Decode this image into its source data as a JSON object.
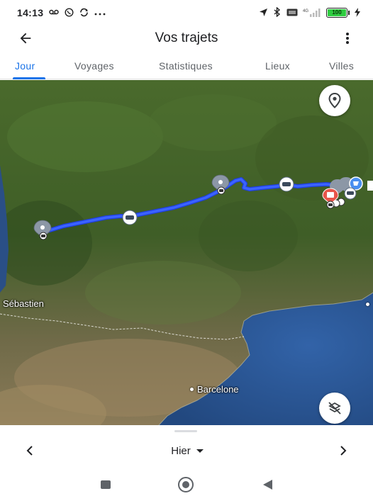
{
  "status_bar": {
    "time": "14:13",
    "left_icons": [
      "voicemail-icon",
      "whatsapp-icon",
      "sync-icon",
      "more-dots-icon"
    ],
    "right_icons": [
      "location-arrow-icon",
      "bluetooth-icon",
      "volte-icon",
      "signal-4g-icon",
      "battery-icon",
      "charging-icon"
    ],
    "signal_label": "4G",
    "battery_level": "100"
  },
  "app_bar": {
    "title": "Vos trajets",
    "back_icon": "arrow-back-icon",
    "menu_icon": "more-vert-icon"
  },
  "tabs": [
    {
      "label": "Jour",
      "active": true
    },
    {
      "label": "Voyages",
      "active": false
    },
    {
      "label": "Statistiques",
      "active": false
    },
    {
      "label": "Lieux",
      "active": false
    },
    {
      "label": "Villes",
      "active": false
    }
  ],
  "map": {
    "labels": {
      "san_sebastian": "Sébastien",
      "barcelona": "Barcelone"
    },
    "route_color": "#2f5bff",
    "fab_top_icon": "place-icon",
    "fab_bottom_icon": "layers-off-icon"
  },
  "bottom_sheet": {
    "prev_icon": "chevron-left-icon",
    "date_label": "Hier",
    "dropdown_icon": "arrow-drop-down-icon",
    "next_icon": "chevron-right-icon"
  },
  "system_nav": {
    "recent_icon": "square-icon",
    "home_icon": "circle-icon",
    "back_icon": "triangle-back-icon"
  },
  "colors": {
    "accent": "#1a73e8",
    "route": "#2f5bff",
    "sea": "#2d5a9a",
    "pin_grey": "#8c97a6",
    "pin_red": "#e8554a"
  }
}
